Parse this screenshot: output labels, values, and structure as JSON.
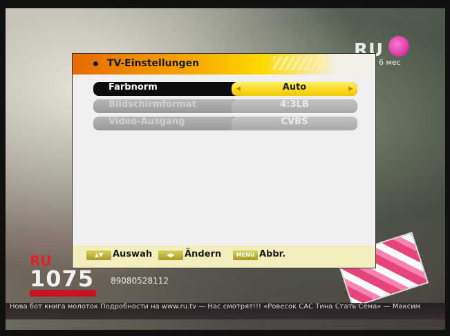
{
  "channel": {
    "logo_text": "RU",
    "logo_sub": "6 мес",
    "bottom_logo": "RU",
    "frequency": "1075",
    "phone": "89080528112"
  },
  "menu": {
    "title": "TV-Einstellungen",
    "rows": [
      {
        "label": "Farbnorm",
        "value": "Auto",
        "selected": true
      },
      {
        "label": "Bildschirmformat",
        "value": "4:3LB",
        "selected": false
      },
      {
        "label": "Video-Ausgang",
        "value": "CVBS",
        "selected": false
      }
    ],
    "footer": {
      "select_key_icon": "up-down-arrows-icon",
      "select_label": "Auswah",
      "change_key_icon": "left-right-arrows-icon",
      "change_label": "Ändern",
      "menu_key_text": "MENU",
      "cancel_label": "Abbr."
    }
  },
  "ticker": {
    "text": "Нова бот книга молоток  Подробности на www.ru.tv  —  Нас смотрят!!! «Ровесок САС Тина Стать Сёма»  —  Максим"
  }
}
